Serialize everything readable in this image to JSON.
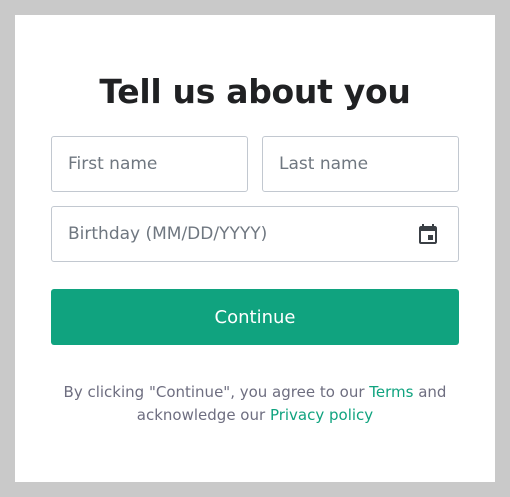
{
  "title": "Tell us about you",
  "first_name": {
    "placeholder": "First name",
    "value": ""
  },
  "last_name": {
    "placeholder": "Last name",
    "value": ""
  },
  "birthday": {
    "placeholder": "Birthday (MM/DD/YYYY)",
    "value": "",
    "icon": "calendar-icon"
  },
  "continue_label": "Continue",
  "legal": {
    "prefix": "By clicking \"Continue\", you agree to our ",
    "terms_label": "Terms",
    "middle": " and acknowledge our ",
    "privacy_label": "Privacy policy"
  },
  "colors": {
    "accent": "#10a37f",
    "title": "#202123",
    "border": "#c2c8d0",
    "backdrop": "#c9c9c9",
    "muted_text": "#6e6e80"
  }
}
